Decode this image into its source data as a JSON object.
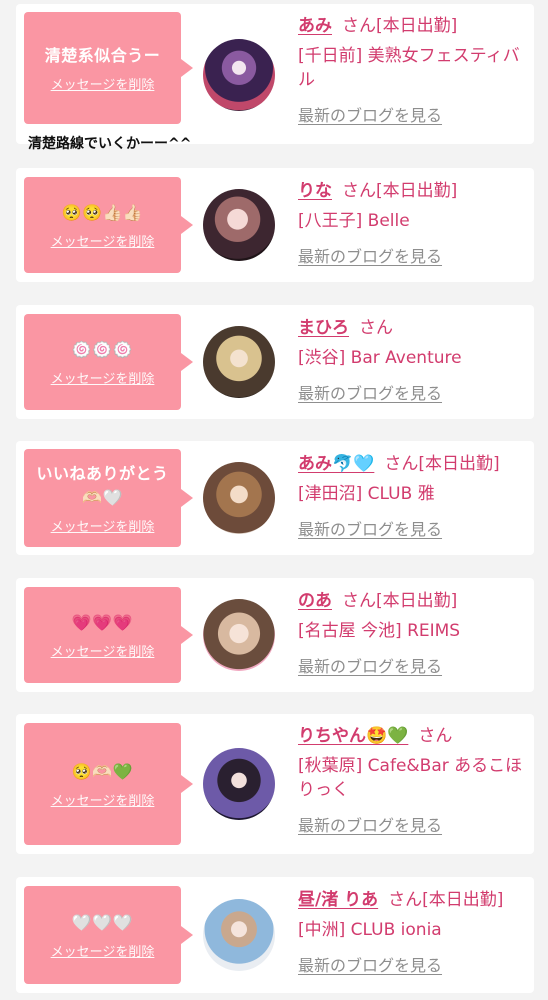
{
  "common": {
    "delete_label": "メッセージを削除",
    "blog_label": "最新のブログを見る"
  },
  "note": "清楚路線でいくかーー^^",
  "cards": [
    {
      "message": "清楚系似合うー",
      "name": "あみ",
      "suffix": "さん[本日出勤]",
      "shop": "[千日前] 美熟女フェスティバル"
    },
    {
      "message": "🥺🥺👍🏻👍🏻",
      "name": "りな",
      "suffix": "さん[本日出勤]",
      "shop": "[八王子] Belle"
    },
    {
      "message": "🍥🍥🍥",
      "name": "まひろ",
      "suffix": "さん",
      "shop": "[渋谷] Bar Aventure"
    },
    {
      "message": "いいねありがとう🫶🏻🤍",
      "name": "あみ🐬🩵",
      "suffix": "さん[本日出勤]",
      "shop": "[津田沼] CLUB 雅"
    },
    {
      "message": "💗💗💗",
      "name": "のあ",
      "suffix": "さん[本日出勤]",
      "shop": "[名古屋 今池] REIMS"
    },
    {
      "message": "🥺🫶🏻💚",
      "name": "りちやん🤩💚",
      "suffix": "さん",
      "shop": "[秋葉原] Cafe&Bar あるこほりっく"
    },
    {
      "message": "🤍🤍🤍",
      "name": "昼/渚 りあ",
      "suffix": "さん[本日出勤]",
      "shop": "[中洲] CLUB ionia"
    }
  ]
}
